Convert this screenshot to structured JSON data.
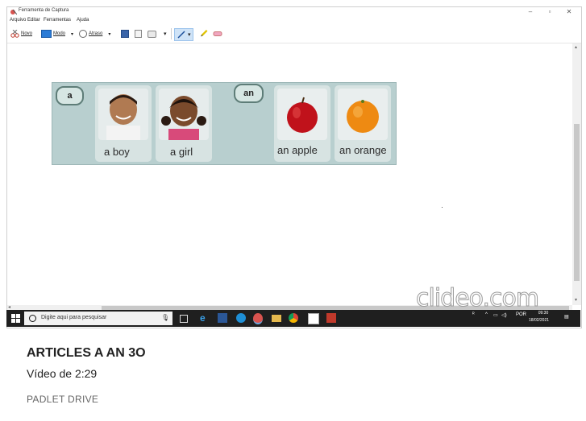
{
  "window": {
    "title": "Ferramenta de Captura",
    "controls": {
      "minimize": "–",
      "maximize": "▫",
      "close": "✕"
    }
  },
  "menu": [
    "Arquivo",
    "Editar",
    "Ferramentas",
    "Ajuda"
  ],
  "toolbar": {
    "new_label": "Novo",
    "mode_label": "Modo",
    "delay_label": "Atraso"
  },
  "poster": {
    "pill_a": "a",
    "pill_an": "an",
    "captions": [
      "a boy",
      "a girl",
      "an apple",
      "an orange"
    ]
  },
  "watermark": "clideo.com",
  "taskbar": {
    "search_placeholder": "Digite aqui para pesquisar",
    "lang": "POR",
    "time": "09:30",
    "date": "18/02/2021"
  },
  "video": {
    "title": "ARTICLES A AN 3O",
    "subtitle": "Vídeo de 2:29",
    "source": "PADLET DRIVE"
  }
}
